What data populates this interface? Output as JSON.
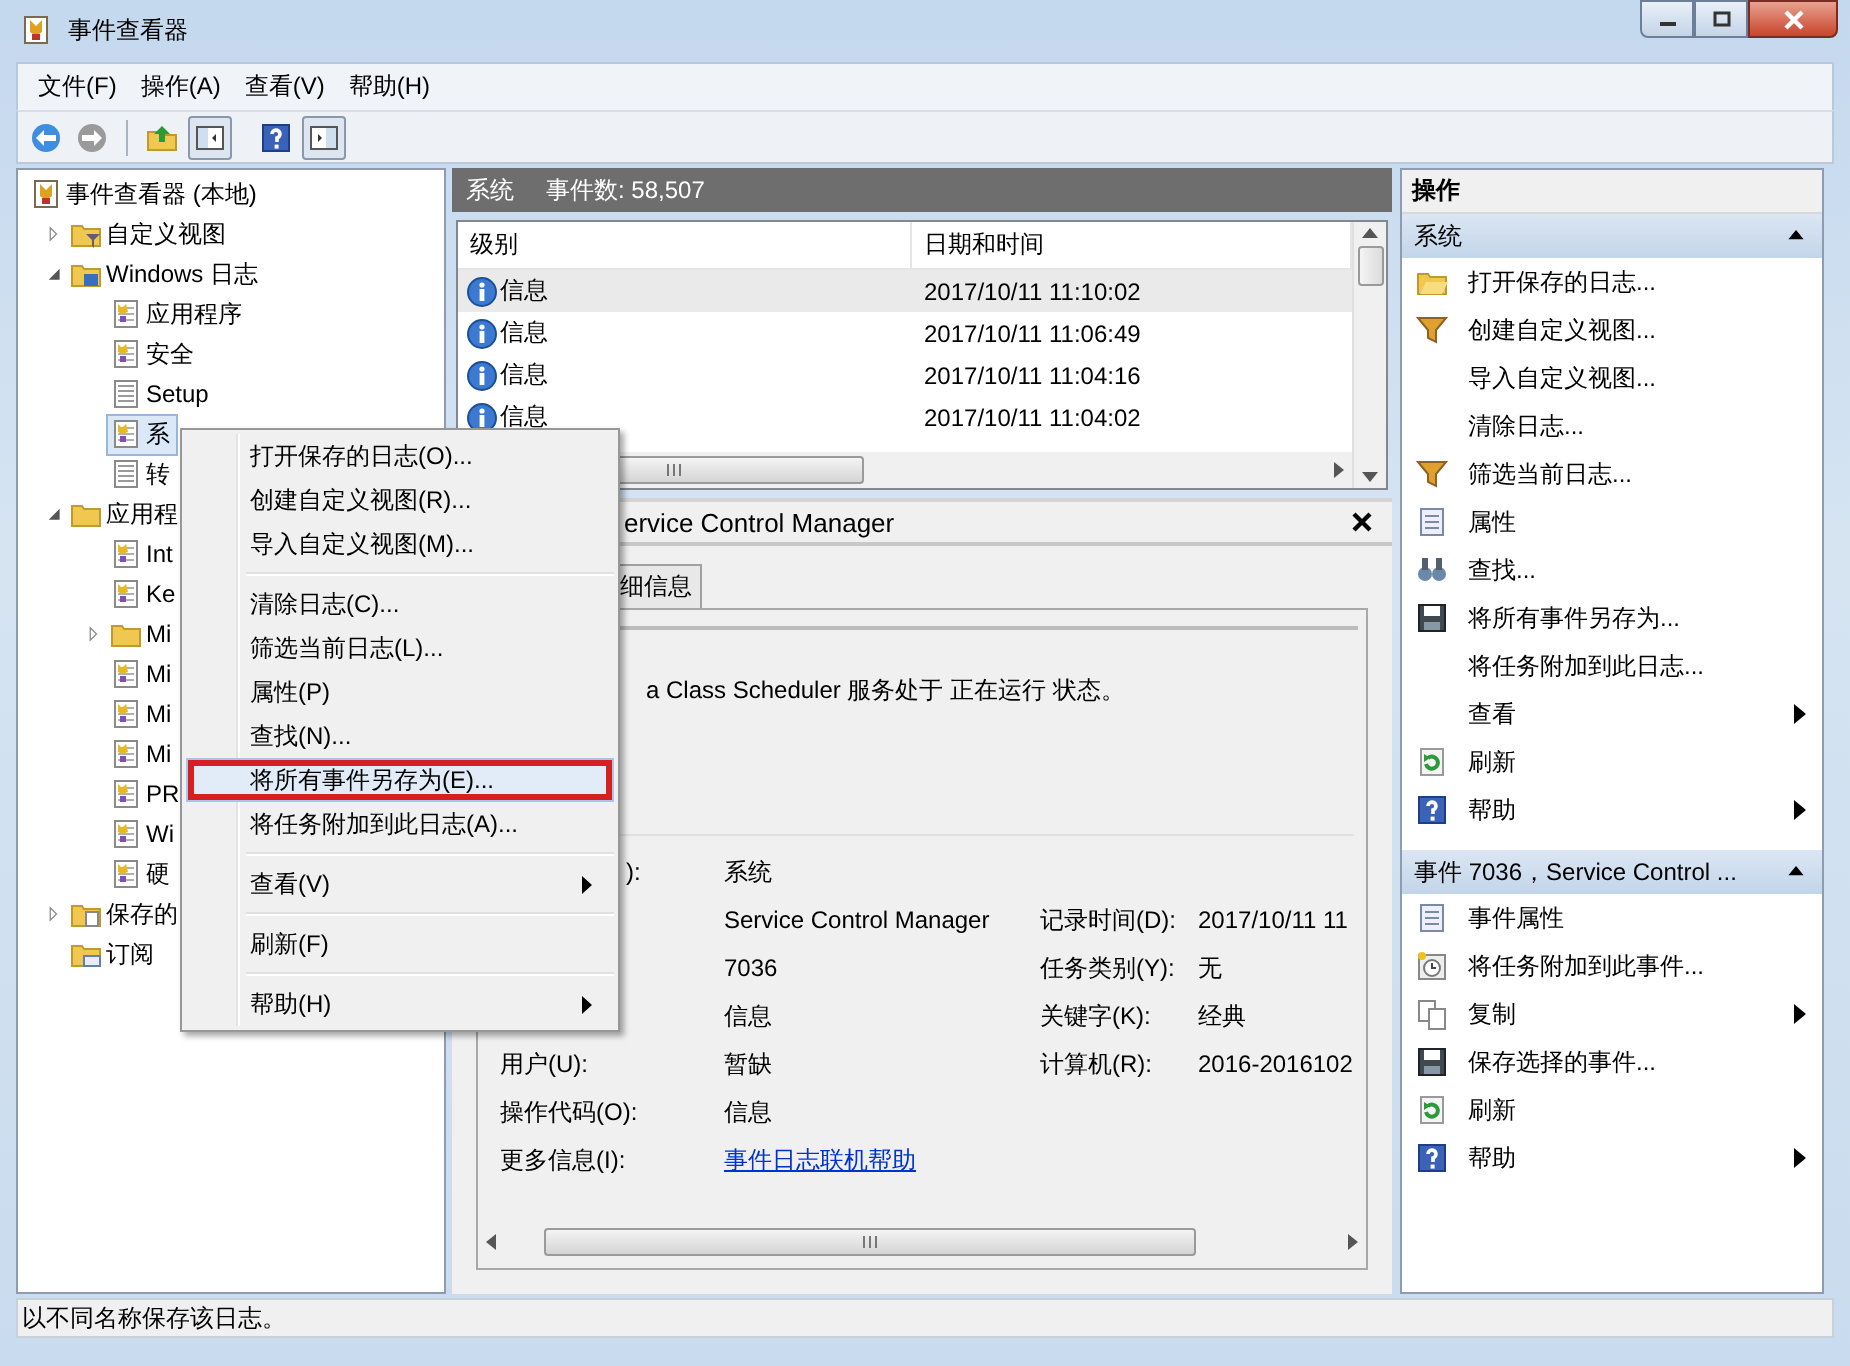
{
  "window": {
    "title": "事件查看器"
  },
  "menu_bar": [
    {
      "label": "文件(F)"
    },
    {
      "label": "操作(A)"
    },
    {
      "label": "查看(V)"
    },
    {
      "label": "帮助(H)"
    }
  ],
  "tree": [
    {
      "label": "事件查看器 (本地)",
      "kind": "root",
      "selected": false,
      "children": [
        {
          "label": "自定义视图",
          "kind": "views",
          "expanded": false,
          "selected": false
        },
        {
          "label": "Windows 日志",
          "kind": "winlogs",
          "expanded": true,
          "selected": false,
          "children": [
            {
              "label": "应用程序",
              "kind": "log",
              "selected": false
            },
            {
              "label": "安全",
              "kind": "log",
              "selected": false
            },
            {
              "label": "Setup",
              "kind": "plainlog",
              "selected": false
            },
            {
              "label": "系",
              "kind": "log",
              "selected": true
            },
            {
              "label": "转",
              "kind": "plainlog",
              "selected": false
            }
          ]
        },
        {
          "label": "应用程",
          "kind": "folder",
          "expanded": true,
          "selected": false,
          "children": [
            {
              "label": "Int",
              "kind": "log",
              "selected": false
            },
            {
              "label": "Ke",
              "kind": "log",
              "selected": false
            },
            {
              "label": "Mi",
              "kind": "folder",
              "expanded": false,
              "selected": false
            },
            {
              "label": "Mi",
              "kind": "log",
              "selected": false
            },
            {
              "label": "Mi",
              "kind": "log",
              "selected": false
            },
            {
              "label": "Mi",
              "kind": "log",
              "selected": false
            },
            {
              "label": "PR",
              "kind": "log",
              "selected": false
            },
            {
              "label": "Wi",
              "kind": "log",
              "selected": false
            },
            {
              "label": "硬",
              "kind": "log",
              "selected": false
            }
          ]
        },
        {
          "label": "保存的",
          "kind": "saved",
          "expanded": false,
          "selected": false
        },
        {
          "label": "订阅",
          "kind": "subscriptions",
          "selected": false
        }
      ]
    }
  ],
  "events": {
    "log_name": "系统",
    "count": "事件数: 58,507",
    "columns": [
      "级别",
      "日期和时间"
    ],
    "rows": [
      {
        "severity": "信息",
        "time": "2017/10/11 11:10:02",
        "selected": true
      },
      {
        "severity": "信息",
        "time": "2017/10/11 11:06:49",
        "selected": false
      },
      {
        "severity": "信息",
        "time": "2017/10/11 11:04:16",
        "selected": false
      },
      {
        "severity": "信息",
        "time": "2017/10/11 11:04:02",
        "selected": false
      }
    ]
  },
  "detail": {
    "title": "ervice Control Manager",
    "tabs": [
      {
        "label": "细信息",
        "selected": false
      }
    ],
    "message": "a Class Scheduler 服务处于 正在运行 状态。",
    "fields": [
      {
        "label": "):",
        "value": "系统",
        "kind": "text"
      },
      {
        "value": "Service Control Manager",
        "kind": "text",
        "label2": "记录时间(D):",
        "value2": "2017/10/11 11"
      },
      {
        "value": "7036",
        "kind": "text",
        "label2": "任务类别(Y):",
        "value2": "无"
      },
      {
        "value": "信息",
        "kind": "text",
        "label2": "关键字(K):",
        "value2": "经典"
      },
      {
        "label": "用户(U):",
        "value": "暂缺",
        "kind": "text",
        "label2": "计算机(R):",
        "value2": "2016-2016102"
      },
      {
        "label": "操作代码(O):",
        "value": "信息",
        "kind": "text"
      },
      {
        "label": "更多信息(I):",
        "value": "事件日志联机帮助",
        "kind": "link"
      }
    ]
  },
  "context_menu": {
    "groups": [
      [
        {
          "label": "打开保存的日志(O)...",
          "submenu": false,
          "selected": false,
          "marked": false
        },
        {
          "label": "创建自定义视图(R)...",
          "submenu": false,
          "selected": false,
          "marked": false
        },
        {
          "label": "导入自定义视图(M)...",
          "submenu": false,
          "selected": false,
          "marked": false
        }
      ],
      [
        {
          "label": "清除日志(C)...",
          "submenu": false,
          "selected": false,
          "marked": false
        },
        {
          "label": "筛选当前日志(L)...",
          "submenu": false,
          "selected": false,
          "marked": false
        },
        {
          "label": "属性(P)",
          "submenu": false,
          "selected": false,
          "marked": false
        },
        {
          "label": "查找(N)...",
          "submenu": false,
          "selected": false,
          "marked": false
        },
        {
          "label": "将所有事件另存为(E)...",
          "submenu": false,
          "selected": true,
          "marked": true
        },
        {
          "label": "将任务附加到此日志(A)...",
          "submenu": false,
          "selected": false,
          "marked": false
        }
      ],
      [
        {
          "label": "查看(V)",
          "submenu": true,
          "selected": false,
          "marked": false
        }
      ],
      [
        {
          "label": "刷新(F)",
          "submenu": false,
          "selected": false,
          "marked": false
        }
      ],
      [
        {
          "label": "帮助(H)",
          "submenu": true,
          "selected": false,
          "marked": false
        }
      ]
    ]
  },
  "actions": {
    "title": "操作",
    "sections": [
      {
        "title": "系统",
        "expanded": true,
        "items": [
          {
            "label": "打开保存的日志...",
            "kind": "folder",
            "submenu": false
          },
          {
            "label": "创建自定义视图...",
            "kind": "filter",
            "submenu": false
          },
          {
            "label": "导入自定义视图...",
            "kind": "none",
            "submenu": false
          },
          {
            "label": "清除日志...",
            "kind": "none",
            "submenu": false
          },
          {
            "label": "筛选当前日志...",
            "kind": "filter",
            "submenu": false
          },
          {
            "label": "属性",
            "kind": "sheet",
            "submenu": false
          },
          {
            "label": "查找...",
            "kind": "binoculars",
            "submenu": false
          },
          {
            "label": "将所有事件另存为...",
            "kind": "disk",
            "submenu": false
          },
          {
            "label": "将任务附加到此日志...",
            "kind": "none",
            "submenu": false
          },
          {
            "label": "查看",
            "kind": "none",
            "submenu": true
          },
          {
            "label": "刷新",
            "kind": "refresh",
            "submenu": false
          },
          {
            "label": "帮助",
            "kind": "help",
            "submenu": true
          }
        ]
      },
      {
        "title": "事件 7036，Service Control ...",
        "expanded": true,
        "items": [
          {
            "label": "事件属性",
            "kind": "sheet",
            "submenu": false
          },
          {
            "label": "将任务附加到此事件...",
            "kind": "clock",
            "submenu": false
          },
          {
            "label": "复制",
            "kind": "copy",
            "submenu": true
          },
          {
            "label": "保存选择的事件...",
            "kind": "disk",
            "submenu": false
          },
          {
            "label": "刷新",
            "kind": "refresh",
            "submenu": false
          },
          {
            "label": "帮助",
            "kind": "help",
            "submenu": true
          }
        ]
      }
    ]
  },
  "status_bar": "以不同名称保存该日志。"
}
